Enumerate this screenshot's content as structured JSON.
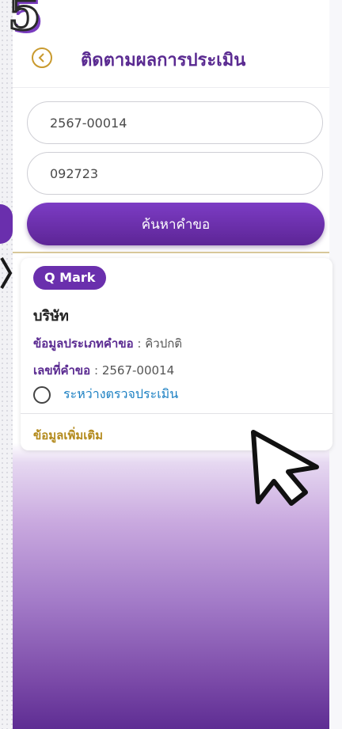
{
  "step_number": "5",
  "header": {
    "title": "ติดตามผลการประเมิน"
  },
  "form": {
    "request_number": "2567-00014",
    "phone": "092723",
    "search_label": "ค้นหาคำขอ"
  },
  "result_card": {
    "tag": "Q Mark",
    "company": "บริษัท",
    "request_type_label": "ข้อมูลประเภทคำขอ",
    "request_type_value": "คิวปกติ",
    "request_no_label": "เลขที่คำขอ",
    "request_no_value": "2567-00014",
    "separator": ":",
    "status": "ระหว่างตรวจประเมิน",
    "more_info": "ข้อมูลเพิ่มเติม"
  },
  "colors": {
    "primary": "#6a2fad",
    "title": "#5a2a91",
    "gold": "#c99a2e",
    "status_blue": "#1a7fc2"
  },
  "icons": {
    "back": "chevron-left-circle-icon",
    "cursor": "mouse-pointer-icon",
    "status": "radio-empty-icon"
  }
}
